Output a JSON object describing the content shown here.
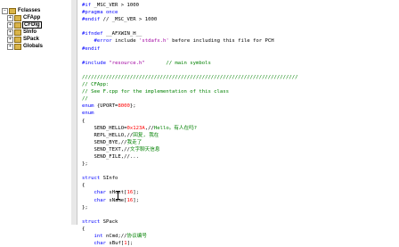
{
  "tree": {
    "root": "Fclasses",
    "items": [
      {
        "label": "CFApp",
        "selected": false
      },
      {
        "label": "CFDlg",
        "selected": true
      },
      {
        "label": "SInfo",
        "selected": false
      },
      {
        "label": "SPack",
        "selected": false
      },
      {
        "label": "Globals",
        "selected": false
      }
    ]
  },
  "code": [
    [
      [
        "kw",
        "#if"
      ],
      [
        "",
        " _MSC_VER > 1000"
      ]
    ],
    [
      [
        "kw",
        "#pragma once"
      ]
    ],
    [
      [
        "kw",
        "#endif"
      ],
      [
        "",
        " // _MSC_VER > 1000"
      ]
    ],
    [
      [
        "",
        ""
      ]
    ],
    [
      [
        "kw",
        "#ifndef"
      ],
      [
        "",
        " __AFXWIN_H__"
      ]
    ],
    [
      [
        "",
        "    "
      ],
      [
        "kw",
        "#error"
      ],
      [
        "",
        " include "
      ],
      [
        "str",
        "'stdafx.h'"
      ],
      [
        "",
        " before including this file for PCH"
      ]
    ],
    [
      [
        "kw",
        "#endif"
      ]
    ],
    [
      [
        "",
        ""
      ]
    ],
    [
      [
        "kw",
        "#include"
      ],
      [
        "",
        " "
      ],
      [
        "str",
        "\"resource.h\""
      ],
      [
        "",
        "       "
      ],
      [
        "cm",
        "// main symbols"
      ]
    ],
    [
      [
        "",
        ""
      ]
    ],
    [
      [
        "cm",
        "////////////////////////////////////////////////////////////////////////"
      ]
    ],
    [
      [
        "cm",
        "// CFApp:"
      ]
    ],
    [
      [
        "cm",
        "// See F.cpp for the implementation of this class"
      ]
    ],
    [
      [
        "cm",
        "//"
      ]
    ],
    [
      [
        "kw",
        "enum"
      ],
      [
        "",
        " {UPORT="
      ],
      [
        "num",
        "8000"
      ],
      [
        "",
        "};"
      ]
    ],
    [
      [
        "kw",
        "enum"
      ]
    ],
    [
      [
        "",
        "{"
      ]
    ],
    [
      [
        "",
        "    SEND_HELLO="
      ],
      [
        "num",
        "0x123A"
      ],
      [
        "",
        ",//"
      ],
      [
        "cm",
        "Hello。有人在吗?"
      ]
    ],
    [
      [
        "",
        "    REPL_HELLO,//"
      ],
      [
        "cm",
        "回复, 我在"
      ]
    ],
    [
      [
        "",
        "    SEND_BYE,//"
      ],
      [
        "cm",
        "我走了"
      ]
    ],
    [
      [
        "",
        "    SEND_TEXT,//"
      ],
      [
        "cm",
        "文字聊天信息"
      ]
    ],
    [
      [
        "",
        "    SEND_FILE,//..."
      ]
    ],
    [
      [
        "",
        "};"
      ]
    ],
    [
      [
        "",
        ""
      ]
    ],
    [
      [
        "kw",
        "struct"
      ],
      [
        "",
        " SInfo"
      ]
    ],
    [
      [
        "",
        "{"
      ]
    ],
    [
      [
        "",
        "    "
      ],
      [
        "kw",
        "char"
      ],
      [
        "",
        " sHost["
      ],
      [
        "num",
        "16"
      ],
      [
        "",
        "];"
      ]
    ],
    [
      [
        "",
        "    "
      ],
      [
        "kw",
        "char"
      ],
      [
        "",
        " sName["
      ],
      [
        "num",
        "16"
      ],
      [
        "",
        "];"
      ]
    ],
    [
      [
        "",
        "};"
      ]
    ],
    [
      [
        "",
        ""
      ]
    ],
    [
      [
        "kw",
        "struct"
      ],
      [
        "",
        " SPack"
      ]
    ],
    [
      [
        "",
        "{"
      ]
    ],
    [
      [
        "",
        "    "
      ],
      [
        "kw",
        "int"
      ],
      [
        "",
        " nCmd;//"
      ],
      [
        "cm",
        "协议编号"
      ]
    ],
    [
      [
        "",
        "    "
      ],
      [
        "kw",
        "char"
      ],
      [
        "",
        " sBuf["
      ],
      [
        "num",
        "1"
      ],
      [
        "",
        "];"
      ]
    ]
  ]
}
